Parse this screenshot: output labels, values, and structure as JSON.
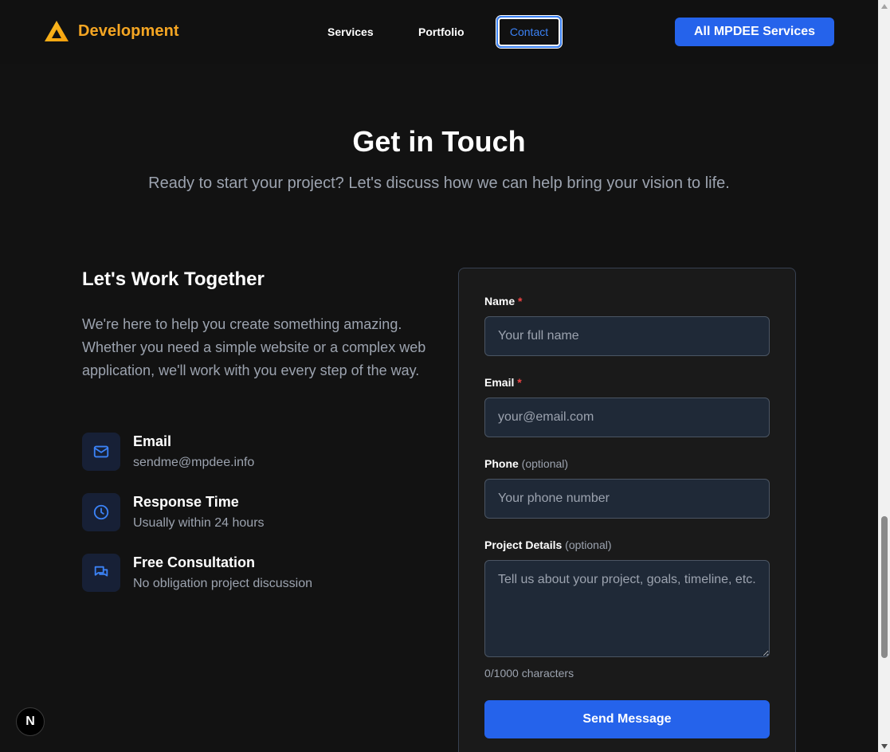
{
  "header": {
    "brand": "Development",
    "nav": {
      "services": "Services",
      "portfolio": "Portfolio",
      "contact": "Contact"
    },
    "cta": "All MPDEE Services"
  },
  "hero": {
    "title": "Get in Touch",
    "subtitle": "Ready to start your project? Let's discuss how we can help bring your vision to life."
  },
  "left": {
    "heading": "Let's Work Together",
    "paragraph": "We're here to help you create something amazing. Whether you need a simple website or a complex web application, we'll work with you every step of the way.",
    "items": [
      {
        "icon": "mail-icon",
        "title": "Email",
        "text": "sendme@mpdee.info"
      },
      {
        "icon": "clock-icon",
        "title": "Response Time",
        "text": "Usually within 24 hours"
      },
      {
        "icon": "chat-icon",
        "title": "Free Consultation",
        "text": "No obligation project discussion"
      }
    ]
  },
  "form": {
    "name": {
      "label": "Name",
      "required": "*",
      "placeholder": "Your full name",
      "value": ""
    },
    "email": {
      "label": "Email",
      "required": "*",
      "placeholder": "your@email.com",
      "value": ""
    },
    "phone": {
      "label": "Phone",
      "optional": "(optional)",
      "placeholder": "Your phone number",
      "value": ""
    },
    "details": {
      "label": "Project Details",
      "optional": "(optional)",
      "placeholder": "Tell us about your project, goals, timeline, etc.",
      "value": ""
    },
    "char_count": "0/1000 characters",
    "submit": "Send Message"
  },
  "badge": {
    "letter": "N"
  },
  "colors": {
    "accent": "#2563eb",
    "brand": "#f5a623",
    "background": "#121212",
    "muted_text": "#9ca3af",
    "required": "#ef4444"
  }
}
